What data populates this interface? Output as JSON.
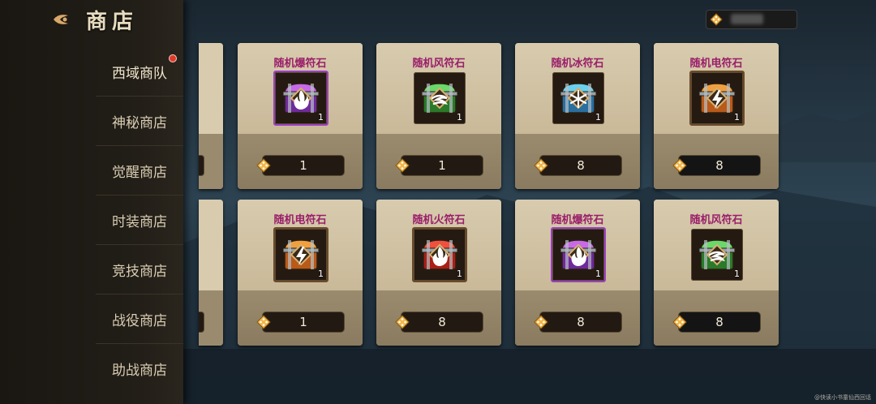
{
  "header": {
    "title": "商店",
    "back_icon": "back-arrow-icon",
    "currency_icon": "diamond-icon"
  },
  "sidebar": {
    "items": [
      {
        "label": "西域商队",
        "badge": true
      },
      {
        "label": "神秘商店",
        "badge": false
      },
      {
        "label": "觉醒商店",
        "badge": false
      },
      {
        "label": "时装商店",
        "badge": false
      },
      {
        "label": "竞技商店",
        "badge": false
      },
      {
        "label": "战役商店",
        "badge": false
      },
      {
        "label": "助战商店",
        "badge": false
      }
    ]
  },
  "cards": [
    {
      "name": "随机爆符石",
      "qty": "1",
      "price": "1",
      "chest": "purple",
      "symbol": "flame"
    },
    {
      "name": "随机风符石",
      "qty": "1",
      "price": "1",
      "chest": "green",
      "symbol": "wind"
    },
    {
      "name": "随机冰符石",
      "qty": "1",
      "price": "8",
      "chest": "blue",
      "symbol": "snow"
    },
    {
      "name": "随机电符石",
      "qty": "1",
      "price": "8",
      "chest": "orange",
      "symbol": "bolt"
    },
    {
      "name": "随机电符石",
      "qty": "1",
      "price": "1",
      "chest": "orange",
      "symbol": "bolt"
    },
    {
      "name": "随机火符石",
      "qty": "1",
      "price": "8",
      "chest": "red",
      "symbol": "flame"
    },
    {
      "name": "随机爆符石",
      "qty": "1",
      "price": "8",
      "chest": "purple",
      "symbol": "flame"
    },
    {
      "name": "随机风符石",
      "qty": "1",
      "price": "8",
      "chest": "green",
      "symbol": "wind"
    }
  ],
  "chest_colors": {
    "purple": [
      "#c86ae8",
      "#6f2a9a"
    ],
    "green": [
      "#6ad86a",
      "#2a7a2a"
    ],
    "blue": [
      "#6ad0f0",
      "#2a6fa0"
    ],
    "orange": [
      "#f0a040",
      "#b85a1a"
    ],
    "red": [
      "#f05040",
      "#a82018"
    ]
  },
  "watermark": "@快读小书童仙西回话"
}
